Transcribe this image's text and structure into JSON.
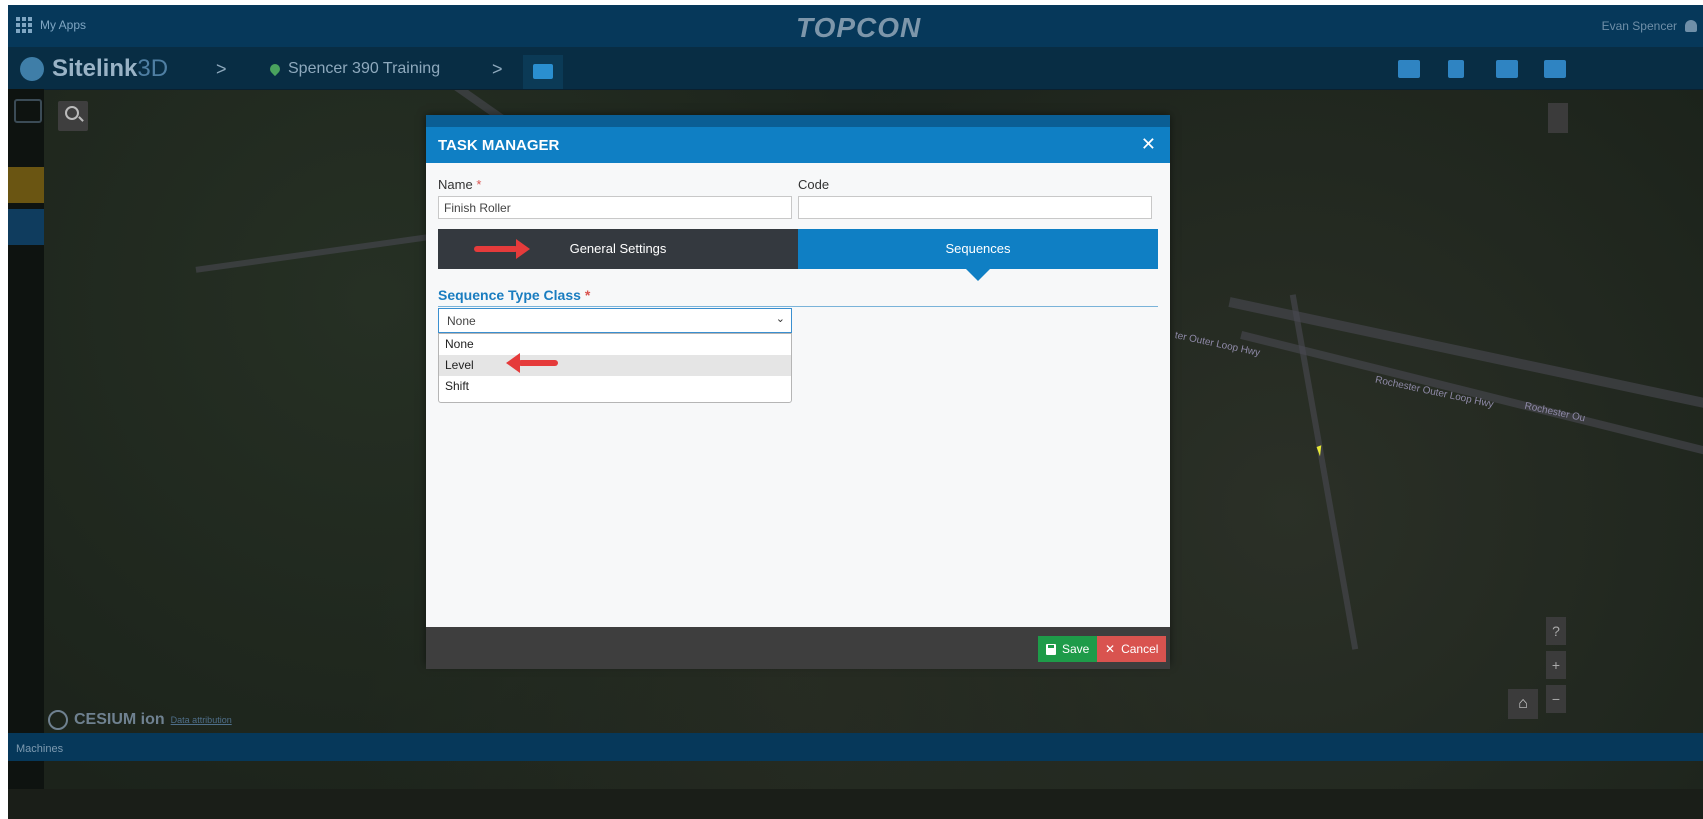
{
  "appbar": {
    "apps_label": "My Apps",
    "brand": "TOPCON",
    "user_name": "Evan Spencer"
  },
  "navbar": {
    "app_name_bold": "Sitelink",
    "app_name_thin": "3D",
    "sep": ">",
    "project": "Spencer 390 Training"
  },
  "map": {
    "labels": [
      "ter Outer Loop Hwy",
      "Rochester Outer Loop Hwy",
      "Rochester Ou"
    ],
    "attribution_brand": "CESIUM ion",
    "attribution_link": "Data attribution",
    "zoom_in": "+",
    "zoom_out": "−",
    "help": "?"
  },
  "bottombar": {
    "label": "Machines"
  },
  "modal": {
    "title": "TASK MANAGER",
    "close": "✕",
    "name_label": "Name",
    "code_label": "Code",
    "required_mark": "*",
    "name_value": "Finish Roller",
    "code_value": "",
    "tabs": [
      "General Settings",
      "Sequences"
    ],
    "active_tab": "Sequences",
    "section_title": "Sequence Type Class",
    "select_value": "None",
    "options": [
      "None",
      "Level",
      "Shift"
    ],
    "highlighted_option": "Level",
    "save_label": "Save",
    "cancel_label": "Cancel"
  },
  "colors": {
    "header": "#0f7fc4",
    "save": "#1e9b49",
    "cancel": "#d9534f",
    "arrow": "#e53b3b"
  }
}
